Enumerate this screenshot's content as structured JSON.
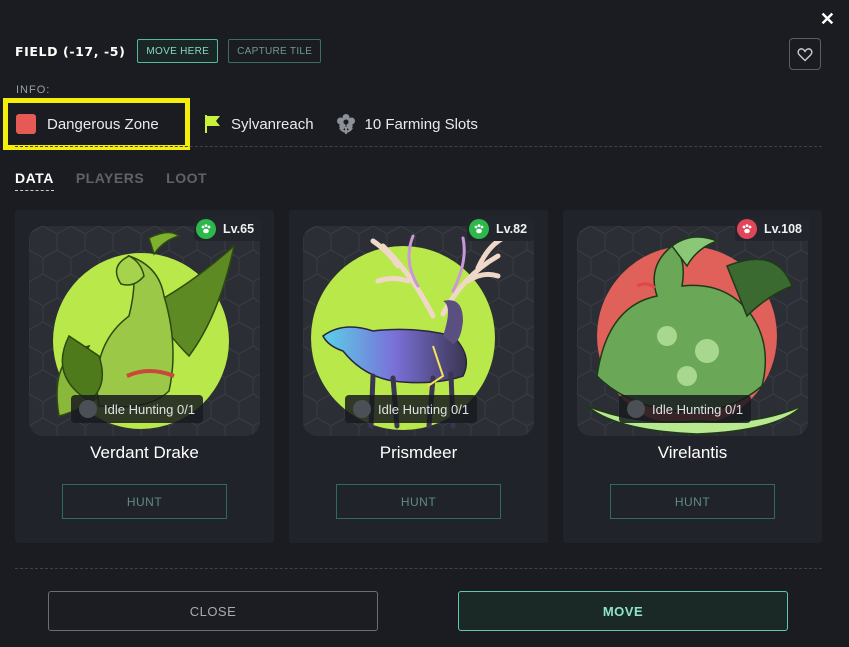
{
  "dialog": {
    "close_symbol": "✕"
  },
  "header": {
    "title": "FIELD (-17, -5)",
    "move_here_label": "MOVE HERE",
    "capture_tile_label": "CAPTURE TILE",
    "favorite_icon": "heart-icon"
  },
  "info": {
    "label": "INFO:",
    "zone": {
      "text": "Dangerous Zone",
      "color": "#e65a55"
    },
    "region": {
      "text": "Sylvanreach",
      "icon": "flag-icon",
      "color": "#c9f03c"
    },
    "slots": {
      "text": "10 Farming Slots",
      "icon": "flower-icon"
    }
  },
  "tabs": [
    {
      "label": "DATA",
      "active": true
    },
    {
      "label": "PLAYERS",
      "active": false
    },
    {
      "label": "LOOT",
      "active": false
    }
  ],
  "monsters": [
    {
      "name": "Verdant Drake",
      "level": "Lv.65",
      "level_color": "#2db84b",
      "idle": "Idle Hunting 0/1",
      "hunt_label": "HUNT",
      "bg_color": "#b8e84a"
    },
    {
      "name": "Prismdeer",
      "level": "Lv.82",
      "level_color": "#2db84b",
      "idle": "Idle Hunting 0/1",
      "hunt_label": "HUNT",
      "bg_color": "#b8e84a"
    },
    {
      "name": "Virelantis",
      "level": "Lv.108",
      "level_color": "#e0455a",
      "idle": "Idle Hunting 0/1",
      "hunt_label": "HUNT",
      "bg_color": "#e0605a"
    }
  ],
  "footer": {
    "close_label": "CLOSE",
    "move_label": "MOVE"
  },
  "colors": {
    "accent": "#5fc9ae",
    "background": "#1a1c21",
    "card": "#202329"
  }
}
